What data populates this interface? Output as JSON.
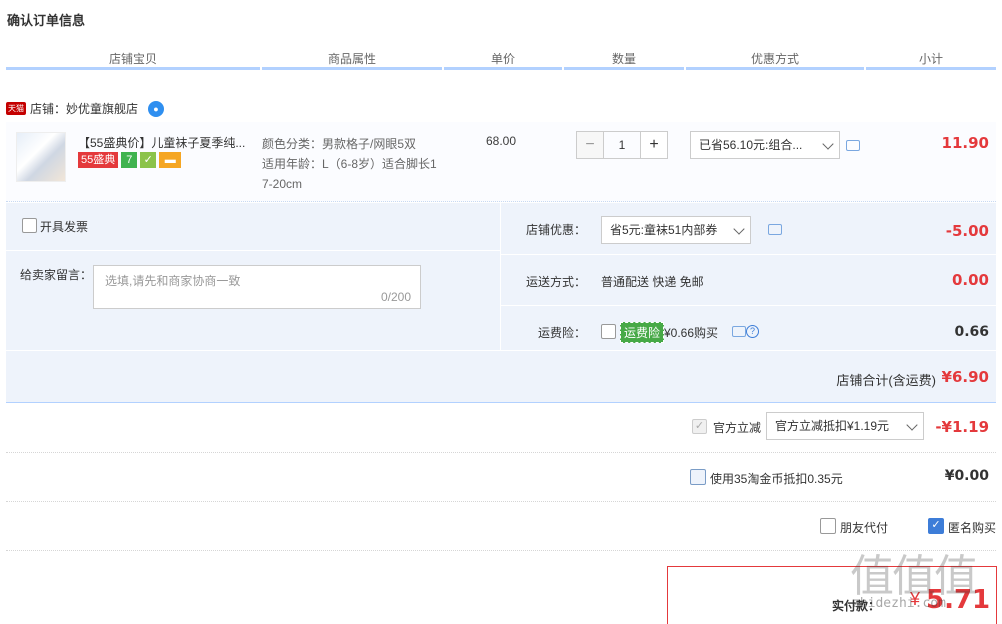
{
  "page_title": "确认订单信息",
  "columns": [
    "店铺宝贝",
    "商品属性",
    "单价",
    "数量",
    "优惠方式",
    "小计"
  ],
  "shop": {
    "badge": "天猫",
    "label": "店铺：妙优童旗舰店"
  },
  "item": {
    "title": "【55盛典价】儿童袜子夏季纯...",
    "badges": {
      "promo": "55盛典",
      "seven": "7"
    },
    "attr_color": "颜色分类：男款格子/网眼5双",
    "attr_age": "适用年龄：L（6-8岁）适合脚长1",
    "attr_age2": "7-20cm",
    "price": "68.00",
    "qty_minus": "−",
    "qty": "1",
    "qty_plus": "+",
    "discount_select": "已省56.10元:组合...",
    "subtotal": "11.90"
  },
  "invoice_label": "开具发票",
  "message": {
    "label": "给卖家留言：",
    "placeholder": "选填,请先和商家协商一致",
    "counter": "0/200"
  },
  "shop_discount": {
    "label": "店铺优惠：",
    "select": "省5元:童袜51内部券",
    "amount": "-5.00"
  },
  "shipping": {
    "label": "运送方式：",
    "value": "普通配送 快递 免邮",
    "amount": "0.00"
  },
  "insurance": {
    "label": "运费险：",
    "tag": "运费险",
    "price_text": "¥0.66购买",
    "help": "?",
    "amount": "0.66"
  },
  "shop_total": {
    "label": "店铺合计(含运费)",
    "amount": "¥6.90"
  },
  "official": {
    "label": "官方立减",
    "select": "官方立减抵扣¥1.19元",
    "amount": "-¥1.19"
  },
  "coins": {
    "label": "使用35淘金币抵扣0.35元",
    "amount": "¥0.00"
  },
  "friend_pay": "朋友代付",
  "anonymous": "匿名购买",
  "pay": {
    "label": "实付款：",
    "currency": "¥",
    "amount": "5.71"
  },
  "watermark": {
    "logo": "值值值",
    "text": "zhidezhi.com"
  }
}
